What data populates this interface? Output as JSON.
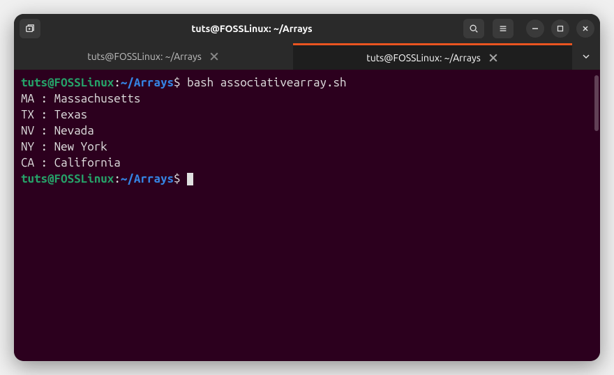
{
  "window": {
    "title": "tuts@FOSSLinux: ~/Arrays"
  },
  "tabs": [
    {
      "label": "tuts@FOSSLinux: ~/Arrays",
      "active": false
    },
    {
      "label": "tuts@FOSSLinux: ~/Arrays",
      "active": true
    }
  ],
  "prompt": {
    "user": "tuts",
    "at": "@",
    "host": "FOSSLinux",
    "colon": ":",
    "path": "~/Arrays",
    "symbol": "$"
  },
  "command": " bash associativearray.sh",
  "output": [
    "MA : Massachusetts",
    "TX : Texas",
    "NV : Nevada",
    "NY : New York",
    "CA : California"
  ],
  "icons": {
    "new_tab": "new-tab-icon",
    "search": "search-icon",
    "menu": "hamburger-icon",
    "minimize": "minimize-icon",
    "maximize": "maximize-icon",
    "close": "close-icon",
    "tab_close": "close-icon",
    "dropdown": "chevron-down-icon"
  }
}
